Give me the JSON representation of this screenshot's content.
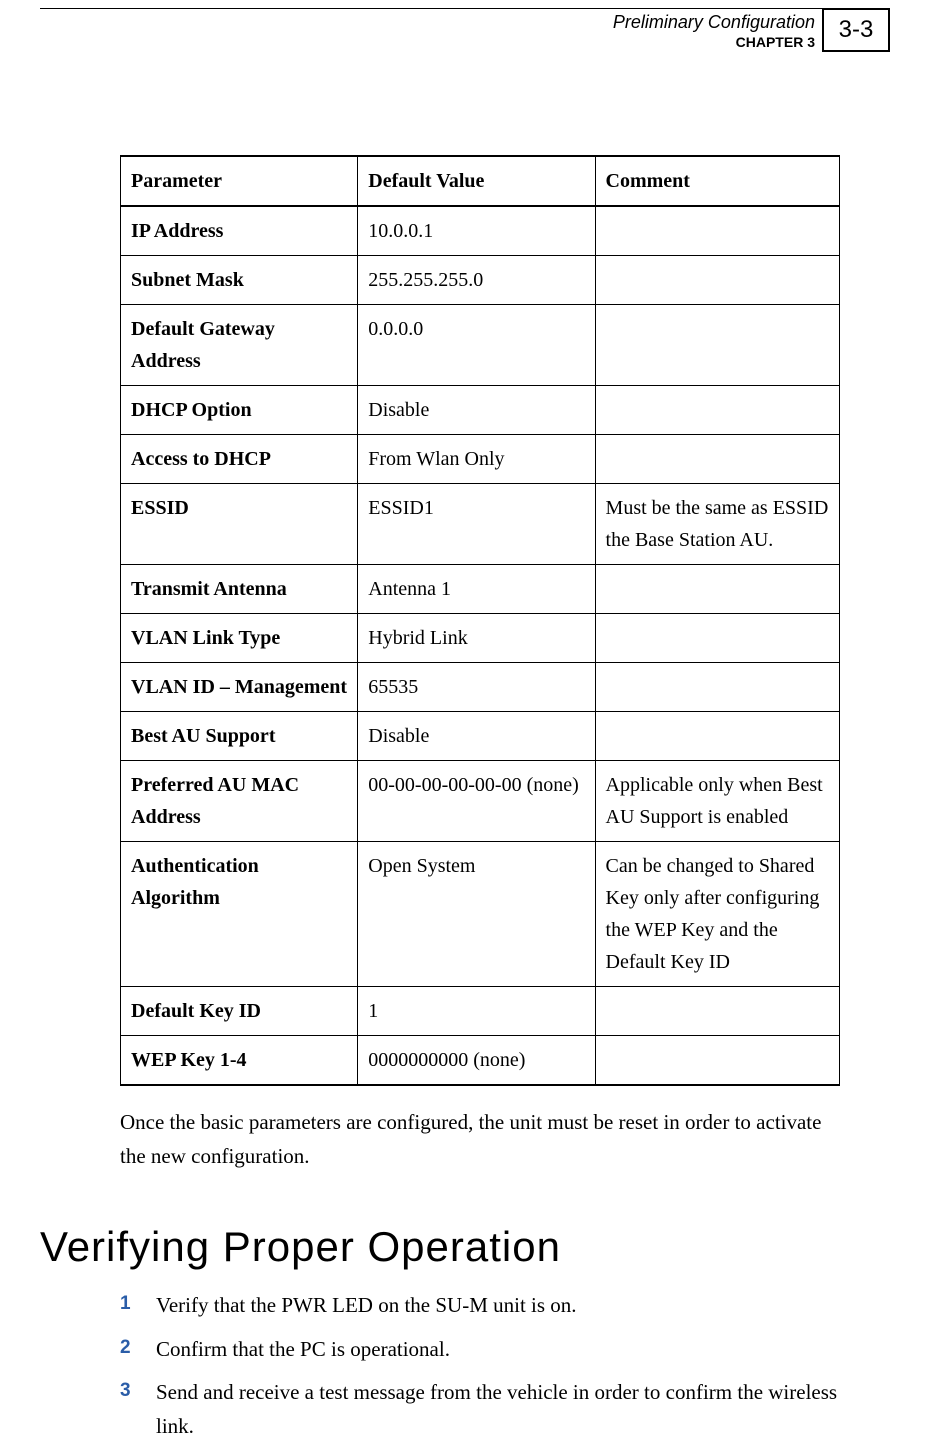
{
  "header": {
    "title": "Preliminary Configuration",
    "chapter": "CHAPTER 3",
    "pageNumber": "3-3"
  },
  "table": {
    "headers": [
      "Parameter",
      "Default Value",
      "Comment"
    ],
    "rows": [
      {
        "param": "IP Address",
        "value": "10.0.0.1",
        "comment": ""
      },
      {
        "param": "Subnet Mask",
        "value": "255.255.255.0",
        "comment": ""
      },
      {
        "param": "Default Gateway Address",
        "value": "0.0.0.0",
        "comment": ""
      },
      {
        "param": "DHCP Option",
        "value": "Disable",
        "comment": ""
      },
      {
        "param": "Access to DHCP",
        "value": "From Wlan Only",
        "comment": ""
      },
      {
        "param": "ESSID",
        "value": "ESSID1",
        "comment": "Must be the same as ESSID the Base Station AU."
      },
      {
        "param": "Transmit Antenna",
        "value": "Antenna 1",
        "comment": ""
      },
      {
        "param": "VLAN Link Type",
        "value": "Hybrid Link",
        "comment": ""
      },
      {
        "param": "VLAN ID – Management",
        "value": "65535",
        "comment": ""
      },
      {
        "param": "Best AU Support",
        "value": "Disable",
        "comment": ""
      },
      {
        "param": "Preferred AU MAC Address",
        "value": "00-00-00-00-00-00 (none)",
        "comment": "Applicable only when Best AU Support is enabled"
      },
      {
        "param": "Authentication Algorithm",
        "value": "Open System",
        "comment": "Can be changed to Shared Key only after configuring the WEP Key and the Default Key ID"
      },
      {
        "param": "Default Key ID",
        "value": "1",
        "comment": ""
      },
      {
        "param": "WEP Key 1-4",
        "value": "0000000000 (none)",
        "comment": ""
      }
    ]
  },
  "bodyText": "Once the basic parameters are configured, the unit must be reset in order to activate the new configuration.",
  "sectionHeading": "Verifying Proper Operation",
  "steps": [
    {
      "num": "1",
      "text": "Verify that the PWR LED on the SU-M unit is on."
    },
    {
      "num": "2",
      "text": "Confirm that the PC is operational."
    },
    {
      "num": "3",
      "text": "Send and receive a test message from the vehicle in order to confirm the wireless link."
    }
  ]
}
